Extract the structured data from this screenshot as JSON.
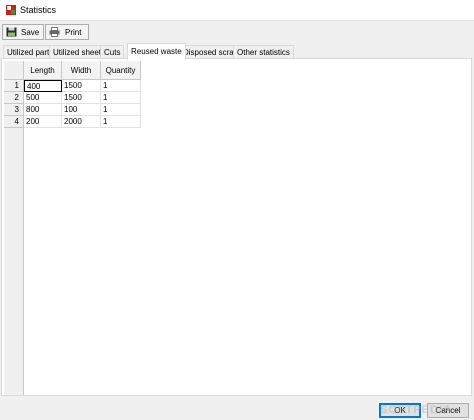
{
  "window": {
    "title": "Statistics",
    "icon": "app-icon-red-green"
  },
  "toolbar": {
    "save_label": "Save",
    "print_label": "Print"
  },
  "tabs": [
    {
      "label": "Utilized parts",
      "active": false
    },
    {
      "label": "Utilized sheets",
      "active": false
    },
    {
      "label": "Cuts",
      "active": false
    },
    {
      "label": "Reused waste",
      "active": true
    },
    {
      "label": "Disposed scrap",
      "active": false
    },
    {
      "label": "Other statistics",
      "active": false
    }
  ],
  "grid": {
    "columns": [
      "Length",
      "Width",
      "Quantity"
    ],
    "rows": [
      {
        "num": "1",
        "cells": [
          "400",
          "1500",
          "1"
        ]
      },
      {
        "num": "2",
        "cells": [
          "500",
          "1500",
          "1"
        ]
      },
      {
        "num": "3",
        "cells": [
          "800",
          "100",
          "1"
        ]
      },
      {
        "num": "4",
        "cells": [
          "200",
          "2000",
          "1"
        ]
      }
    ]
  },
  "footer": {
    "ok_label": "OK",
    "cancel_label": "Cancel"
  },
  "watermark": "SOFTPEDIA"
}
